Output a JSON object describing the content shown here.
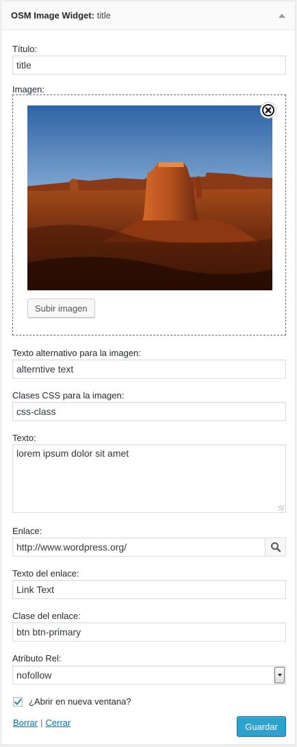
{
  "header": {
    "title": "OSM Image Widget",
    "title_sep": ": ",
    "instance_title": "title"
  },
  "fields": {
    "title_label": "Título:",
    "title_value": "title",
    "image_label": "Imagen:",
    "upload_label": "Subir imagen",
    "alt_label": "Texto alternativo para la imagen:",
    "alt_value": "alterntive text",
    "css_label": "Clases CSS para la imagen:",
    "css_value": "css-class",
    "text_label": "Texto:",
    "text_value": "lorem ipsum dolor sit amet",
    "link_label": "Enlace:",
    "link_value": "http://www.wordpress.org/",
    "link_text_label": "Texto del enlace:",
    "link_text_value": "Link Text",
    "link_class_label": "Clase del enlace:",
    "link_class_value": "btn btn-primary",
    "rel_label": "Atributo Rel:",
    "rel_value": "nofollow",
    "new_window_label": "¿Abrir en nueva ventana?",
    "new_window_checked": true
  },
  "actions": {
    "delete_label": "Borrar",
    "separator": "|",
    "close_label": "Cerrar",
    "save_label": "Guardar"
  },
  "icons": {
    "collapse": "arrow-up-icon",
    "remove_image": "close-circle-icon",
    "search": "search-icon",
    "checkmark": "check-icon"
  },
  "colors": {
    "primary": "#2ea2cc",
    "link": "#0073aa"
  }
}
